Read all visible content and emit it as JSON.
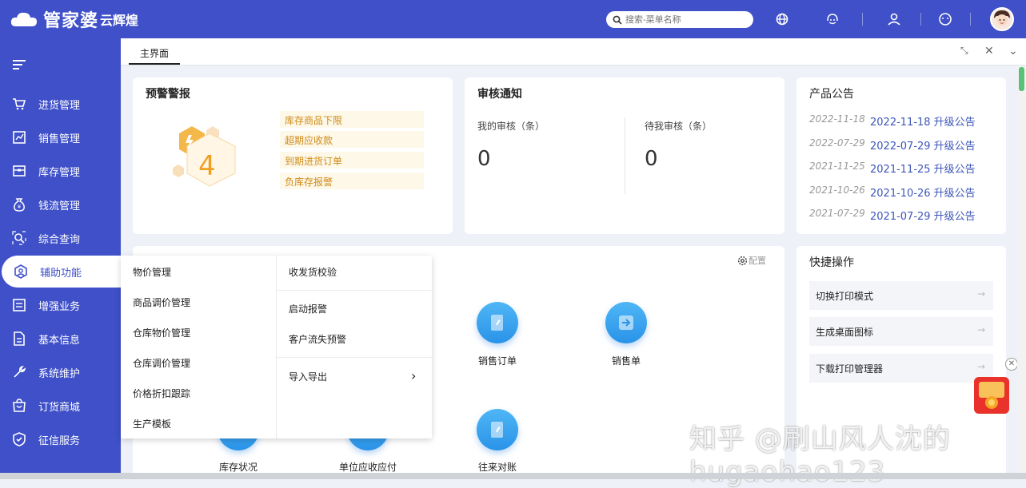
{
  "app": {
    "brand": "管家婆",
    "product": "云辉煌"
  },
  "search": {
    "placeholder": "搜索-菜单名称"
  },
  "sidebar": {
    "items": [
      {
        "label": "进货管理",
        "icon": "cart-icon"
      },
      {
        "label": "销售管理",
        "icon": "chart-icon"
      },
      {
        "label": "库存管理",
        "icon": "box-icon"
      },
      {
        "label": "钱流管理",
        "icon": "money-bag-icon"
      },
      {
        "label": "综合查询",
        "icon": "search-icon"
      },
      {
        "label": "辅助功能",
        "icon": "assist-icon"
      },
      {
        "label": "增强业务",
        "icon": "list-icon"
      },
      {
        "label": "基本信息",
        "icon": "document-icon"
      },
      {
        "label": "系统维护",
        "icon": "wrench-icon"
      },
      {
        "label": "订货商城",
        "icon": "shop-icon"
      },
      {
        "label": "征信服务",
        "icon": "shield-icon"
      }
    ],
    "active_index": 5
  },
  "tabs": {
    "main": "主界面"
  },
  "warning": {
    "title": "预警警报",
    "count": "4",
    "links": [
      "库存商品下限",
      "超期应收款",
      "到期进货订单",
      "负库存报警"
    ]
  },
  "audit": {
    "title": "审核通知",
    "mine_label": "我的审核（条）",
    "mine_value": "0",
    "pending_label": "待我审核（条）",
    "pending_value": "0"
  },
  "announcements": {
    "title": "产品公告",
    "items": [
      {
        "date": "2022-11-18",
        "title": "2022-11-18 升级公告"
      },
      {
        "date": "2022-07-29",
        "title": "2022-07-29 升级公告"
      },
      {
        "date": "2021-11-25",
        "title": "2021-11-25 升级公告"
      },
      {
        "date": "2021-10-26",
        "title": "2021-10-26 升级公告"
      },
      {
        "date": "2021-07-29",
        "title": "2021-07-29 升级公告"
      }
    ]
  },
  "common": {
    "config_label": "配置",
    "functions": [
      "销售订单",
      "销售单",
      "往来对账",
      "库存状况",
      "单位应收应付"
    ]
  },
  "quick": {
    "title": "快捷操作",
    "items": [
      "切换打印模式",
      "生成桌面图标",
      "下载打印管理器"
    ],
    "arrow": "→"
  },
  "popup": {
    "left": [
      "物价管理",
      "商品调价管理",
      "仓库物价管理",
      "仓库调价管理",
      "价格折扣跟踪",
      "生产模板"
    ],
    "right": [
      "收发货校验",
      "启动报警",
      "客户流失预警",
      "导入导出"
    ],
    "submenu_arrow": "›"
  },
  "watermark": "知乎 @刷山风人沈的 hugaohao123",
  "colors": {
    "primary": "#3f50c8",
    "warning": "#f0a020",
    "link": "#3d56b8",
    "func_blue": "#2a93e8"
  }
}
